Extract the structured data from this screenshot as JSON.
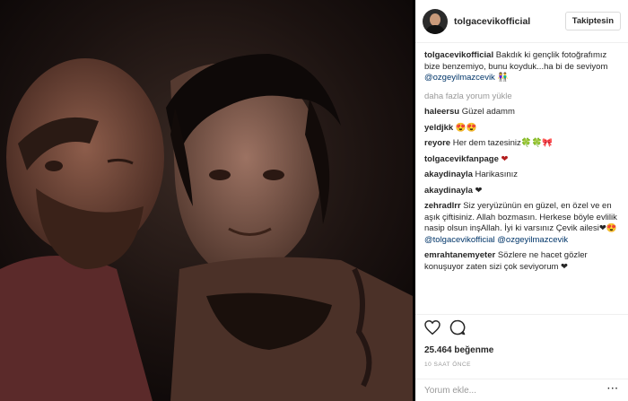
{
  "post": {
    "photo_description": "selfie-photo",
    "colors": {
      "accent": "#003569",
      "heart": "#b31d1d",
      "muted": "#999999"
    }
  },
  "header": {
    "username": "tolgacevikofficial",
    "follow_label": "Takiptesin"
  },
  "caption": {
    "user": "tolgacevikofficial",
    "text": "Bakdık ki gençlik fotoğrafımız bize benzemiyo, bunu koyduk...ha bi de seviyom",
    "mention": "@ozgeyilmazcevik",
    "emoji": "👫"
  },
  "load_more": "daha fazla yorum yükle",
  "comments": [
    {
      "user": "haleersu",
      "text": "Güzel adamm",
      "mentions": ""
    },
    {
      "user": "yeldjkk",
      "text": "😍😍",
      "mentions": ""
    },
    {
      "user": "reyore",
      "text": "Her dem tazesiniz🍀🍀🎀",
      "mentions": ""
    },
    {
      "user": "tolgacevikfanpage",
      "text": "❤",
      "mentions": ""
    },
    {
      "user": "akaydinayla",
      "text": "Harikasınız",
      "mentions": ""
    },
    {
      "user": "akaydinayla",
      "text": "❤",
      "mentions": ""
    },
    {
      "user": "zehradlrr",
      "text": "Siz yeryüzünün en güzel, en özel ve en aşık çiftisiniz. Allah bozmasın. Herkese böyle evlilik nasip olsun inşAllah. İyi ki varsınız Çevik ailesi❤😍",
      "mentions": "@tolgacevikofficial @ozgeyilmazcevik"
    },
    {
      "user": "emrahtanemyeter",
      "text": "Sözlere ne hacet gözler konuşuyor zaten sizi çok seviyorum ❤",
      "mentions": ""
    }
  ],
  "actions": {
    "like_icon": "heart-icon",
    "comment_icon": "comment-icon",
    "likes": "25.464 beğenme",
    "time": "10 SAAT ÖNCE"
  },
  "add_comment": {
    "placeholder": "Yorum ekle...",
    "more_icon": "more-options-icon",
    "more_label": "···"
  }
}
